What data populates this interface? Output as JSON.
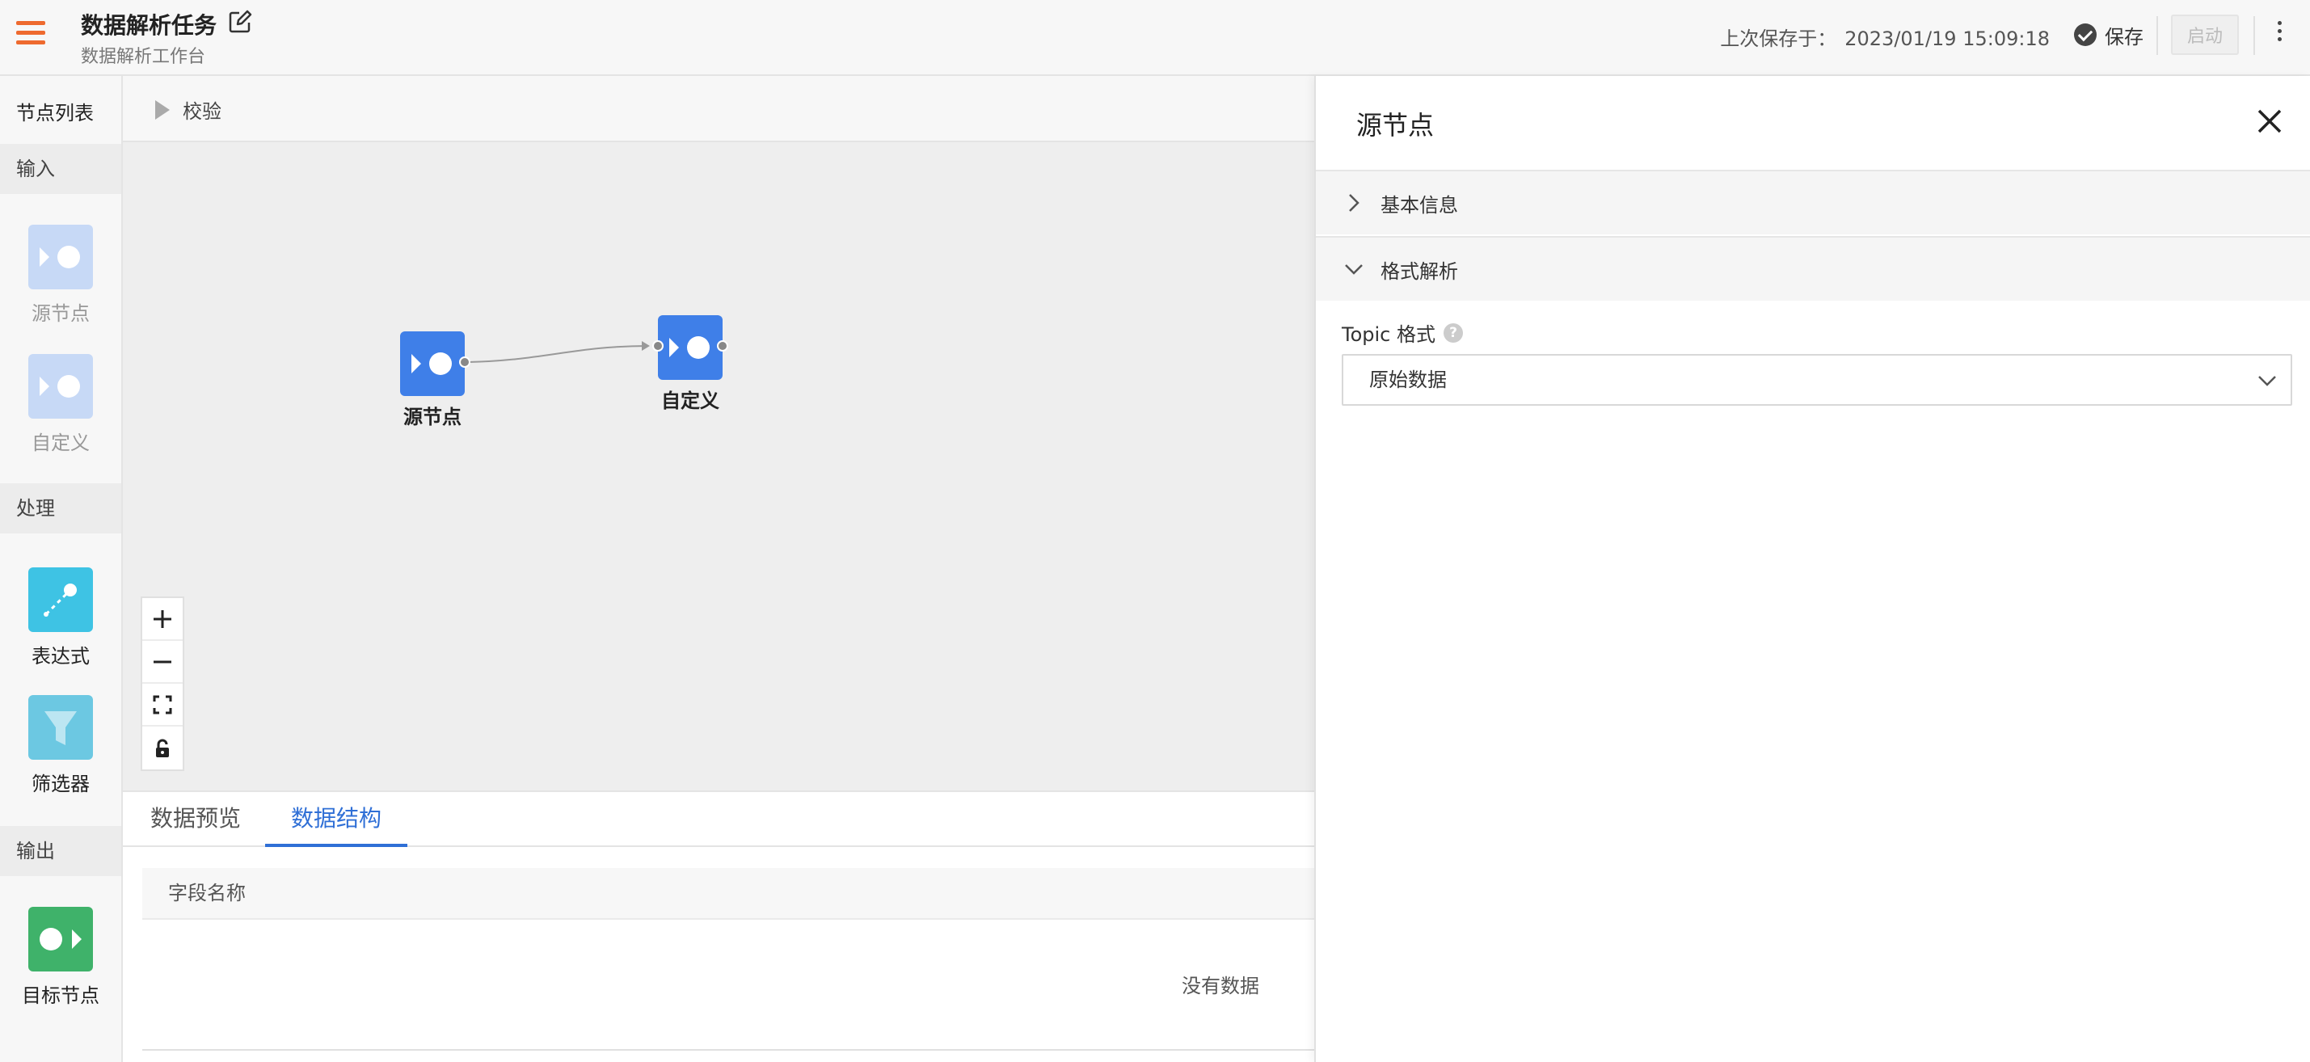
{
  "header": {
    "title": "数据解析任务",
    "subtitle": "数据解析工作台",
    "last_saved_label": "上次保存于：",
    "last_saved_time": "2023/01/19 15:09:18",
    "save_label": "保存",
    "start_label": "启动"
  },
  "node_panel": {
    "title": "节点列表",
    "groups": [
      {
        "label": "输入",
        "items": [
          {
            "label": "源节点",
            "icon": "source-node-icon",
            "disabled": true
          },
          {
            "label": "自定义",
            "icon": "custom-node-icon",
            "disabled": true
          }
        ]
      },
      {
        "label": "处理",
        "items": [
          {
            "label": "表达式",
            "icon": "expression-icon"
          },
          {
            "label": "筛选器",
            "icon": "filter-funnel-icon"
          }
        ]
      },
      {
        "label": "输出",
        "items": [
          {
            "label": "目标节点",
            "icon": "target-node-icon"
          }
        ]
      }
    ]
  },
  "canvas": {
    "validate_label": "校验",
    "nodes": [
      {
        "label": "源节点"
      },
      {
        "label": "自定义"
      }
    ]
  },
  "bottom": {
    "tabs": [
      {
        "label": "数据预览",
        "active": false
      },
      {
        "label": "数据结构",
        "active": true
      }
    ],
    "column_header": "字段名称",
    "empty_text": "没有数据"
  },
  "side_panel": {
    "title": "源节点",
    "sections": [
      {
        "label": "基本信息",
        "expanded": false
      },
      {
        "label": "格式解析",
        "expanded": true
      }
    ],
    "field_label": "Topic 格式",
    "help_glyph": "?",
    "select_value": "原始数据"
  },
  "colors": {
    "accent_orange": "#ee6a2f",
    "node_blue": "#3f7fe8",
    "expression_cyan": "#3ec3e4",
    "filter_cyan": "#6cc8e2",
    "target_green": "#3fb26a",
    "active_tab_blue": "#2f6fd6"
  }
}
